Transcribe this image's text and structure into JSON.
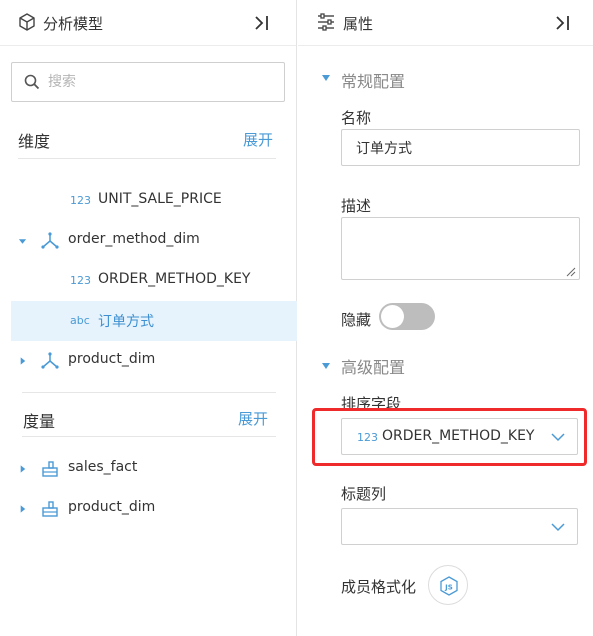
{
  "left_panel": {
    "title": "分析模型",
    "search_placeholder": "搜索",
    "dimensions": {
      "title": "维度",
      "expand_label": "展开",
      "items": [
        {
          "type": "123",
          "label": "UNIT_SALE_PRICE"
        },
        {
          "label": "order_method_dim",
          "expanded": true
        },
        {
          "type": "123",
          "label": "ORDER_METHOD_KEY"
        },
        {
          "type": "abc",
          "label": "订单方式",
          "selected": true
        },
        {
          "label": "product_dim",
          "expanded": false
        }
      ]
    },
    "measures": {
      "title": "度量",
      "expand_label": "展开",
      "items": [
        {
          "label": "sales_fact"
        },
        {
          "label": "product_dim"
        }
      ]
    }
  },
  "right_panel": {
    "title": "属性",
    "general": {
      "title": "常规配置",
      "name_label": "名称",
      "name_value": "订单方式",
      "desc_label": "描述",
      "desc_value": "",
      "hidden_label": "隐藏",
      "hidden_on": false
    },
    "advanced": {
      "title": "高级配置",
      "sort_label": "排序字段",
      "sort_type": "123",
      "sort_value": "ORDER_METHOD_KEY",
      "caption_label": "标题列",
      "caption_value": "",
      "format_label": "成员格式化"
    }
  },
  "colors": {
    "accent": "#4a9ad6",
    "selected_bg": "#e6f3fc",
    "highlight": "#ee2a2a",
    "toggle_off": "#bdbdbd"
  },
  "icons": [
    "cube-icon",
    "collapse-panel-icon",
    "sliders-icon",
    "search-icon",
    "caret-down-icon",
    "caret-right-icon",
    "dimension-icon",
    "measure-table-icon",
    "chevron-down-icon",
    "js-icon"
  ]
}
